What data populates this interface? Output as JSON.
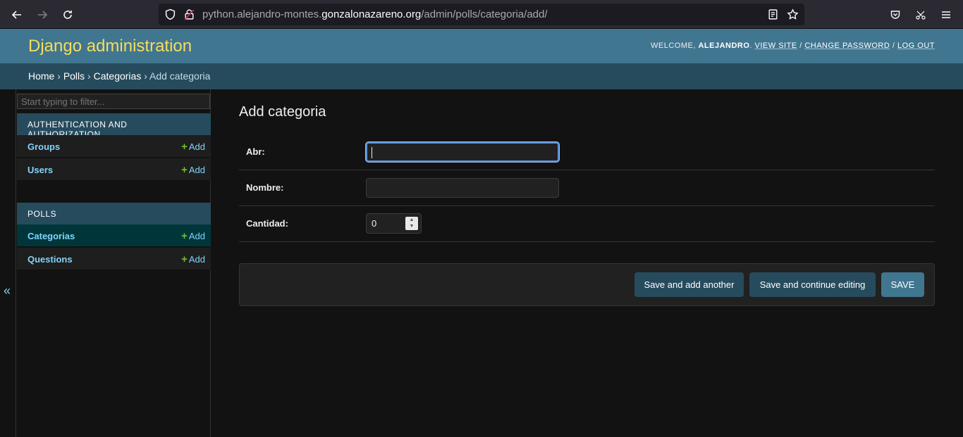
{
  "browser": {
    "url_prefix": "python.alejandro-montes.",
    "url_domain": "gonzalonazareno.org",
    "url_path": "/admin/polls/categoria/add/"
  },
  "header": {
    "branding": "Django administration",
    "welcome": "WELCOME,",
    "username": "ALEJANDRO",
    "view_site": "VIEW SITE",
    "change_password": "CHANGE PASSWORD",
    "log_out": "LOG OUT"
  },
  "breadcrumbs": {
    "home": "Home",
    "polls": "Polls",
    "categorias": "Categorias",
    "current": "Add categoria"
  },
  "sidebar": {
    "filter_placeholder": "Start typing to filter...",
    "modules": [
      {
        "caption": "AUTHENTICATION AND AUTHORIZATION",
        "rows": [
          {
            "label": "Groups",
            "add": "Add"
          },
          {
            "label": "Users",
            "add": "Add"
          }
        ]
      },
      {
        "caption": "POLLS",
        "rows": [
          {
            "label": "Categorias",
            "add": "Add"
          },
          {
            "label": "Questions",
            "add": "Add"
          }
        ]
      }
    ],
    "collapse_glyph": "«"
  },
  "content": {
    "title": "Add categoria",
    "fields": [
      {
        "label": "Abr:",
        "value": ""
      },
      {
        "label": "Nombre:",
        "value": ""
      },
      {
        "label": "Cantidad:",
        "value": "0"
      }
    ],
    "buttons": {
      "save_add_another": "Save and add another",
      "save_continue": "Save and continue editing",
      "save": "SAVE"
    }
  }
}
